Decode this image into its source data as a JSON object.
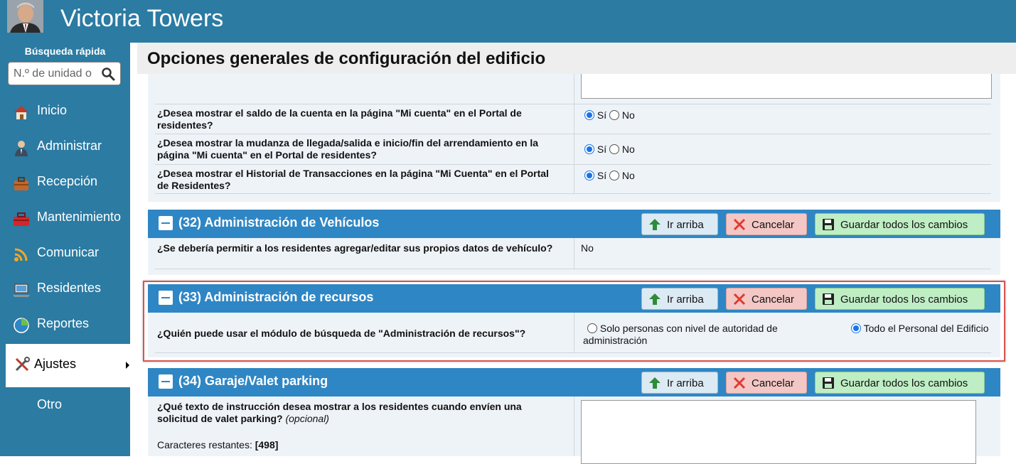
{
  "app": {
    "title": "Victoria Towers",
    "header_color": "#2b7ba3"
  },
  "sidebar": {
    "quick_search_label": "Búsqueda rápida",
    "quick_search_placeholder": "N.º de unidad o",
    "items": [
      {
        "label": "Inicio",
        "icon": "house-icon"
      },
      {
        "label": "Administrar",
        "icon": "person-icon"
      },
      {
        "label": "Recepción",
        "icon": "briefcase-icon"
      },
      {
        "label": "Mantenimiento",
        "icon": "toolbox-icon"
      },
      {
        "label": "Comunicar",
        "icon": "wifi-icon"
      },
      {
        "label": "Residentes",
        "icon": "laptop-icon"
      },
      {
        "label": "Reportes",
        "icon": "pie-chart-icon"
      },
      {
        "label": "Ajustes",
        "icon": "tools-icon",
        "active": true
      },
      {
        "label": "Otro"
      }
    ]
  },
  "page": {
    "title": "Opciones generales de configuración del edificio"
  },
  "radio_labels": {
    "yes": "Sí",
    "no": "No"
  },
  "top_section": {
    "rows": [
      {
        "question": "¿Desea mostrar el saldo de la cuenta en la página \"Mi cuenta\" en el Portal de residentes?",
        "selected": "yes"
      },
      {
        "question": "¿Desea mostrar la mudanza de llegada/salida e inicio/fin del arrendamiento en la página \"Mi cuenta\" en el Portal de residentes?",
        "selected": "yes"
      },
      {
        "question": "¿Desea mostrar el Historial de Transacciones en la página \"Mi Cuenta\" en el Portal de Residentes?",
        "selected": "yes"
      }
    ]
  },
  "buttons": {
    "up": "Ir arriba",
    "cancel": "Cancelar",
    "save": "Guardar todos los cambios"
  },
  "section_32": {
    "title": "(32) Administración de Vehículos",
    "question": "¿Se debería permitir a los residentes agregar/editar sus propios datos de vehículo?",
    "answer": "No"
  },
  "section_33": {
    "title": "(33) Administración de recursos",
    "question": "¿Quién puede usar el módulo de búsqueda de \"Administración de recursos\"?",
    "options": [
      {
        "label": "Solo personas con nivel de autoridad de administración",
        "selected": false
      },
      {
        "label": "Todo el Personal del Edificio",
        "selected": true
      }
    ]
  },
  "section_34": {
    "title": "(34) Garaje/Valet parking",
    "question": "¿Qué texto de instrucción desea mostrar a los residentes cuando envíen una solicitud de valet parking?",
    "optional": "(opcional)",
    "chars_label": "Caracteres restantes:",
    "chars_value": "[498]"
  }
}
